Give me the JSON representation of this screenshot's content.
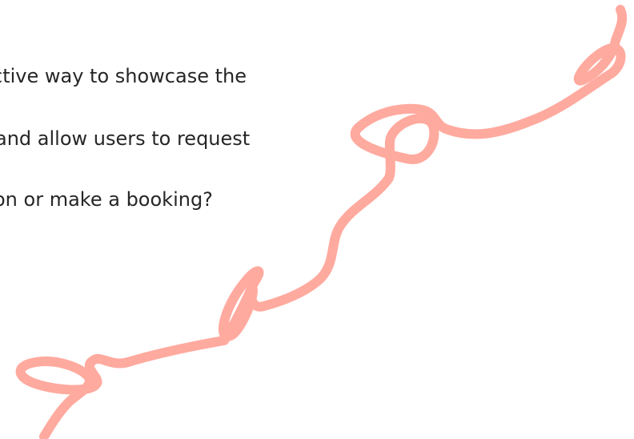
{
  "question": {
    "lines": [
      "ctive way to showcase the",
      "and allow users to request",
      "on or make a booking?"
    ]
  },
  "decoration": {
    "icon": "looped-scribble-line-icon",
    "color": "#ffaa9f"
  }
}
